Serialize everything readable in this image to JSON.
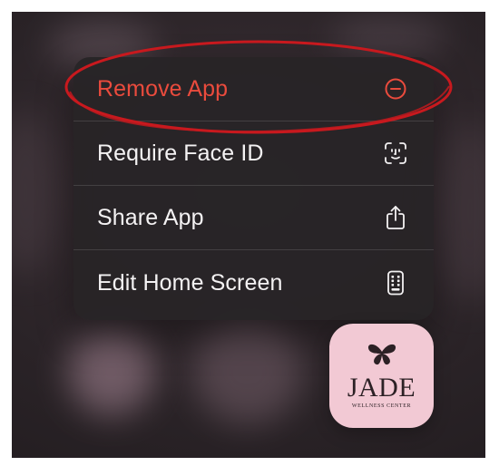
{
  "context_menu": {
    "items": [
      {
        "label": "Remove App",
        "icon": "minus-circle-icon",
        "destructive": true
      },
      {
        "label": "Require Face ID",
        "icon": "face-id-icon",
        "destructive": false
      },
      {
        "label": "Share App",
        "icon": "share-icon",
        "destructive": false
      },
      {
        "label": "Edit Home Screen",
        "icon": "phone-apps-icon",
        "destructive": false
      }
    ],
    "colors": {
      "destructive": "#ea4b3d",
      "text": "#f4f2f3",
      "annotation": "#c8191e",
      "app_icon_background": "#f2c9d4"
    }
  },
  "app_icon": {
    "logo_text": "JADE",
    "logo_subtext": "WELLNESS CENTER"
  }
}
